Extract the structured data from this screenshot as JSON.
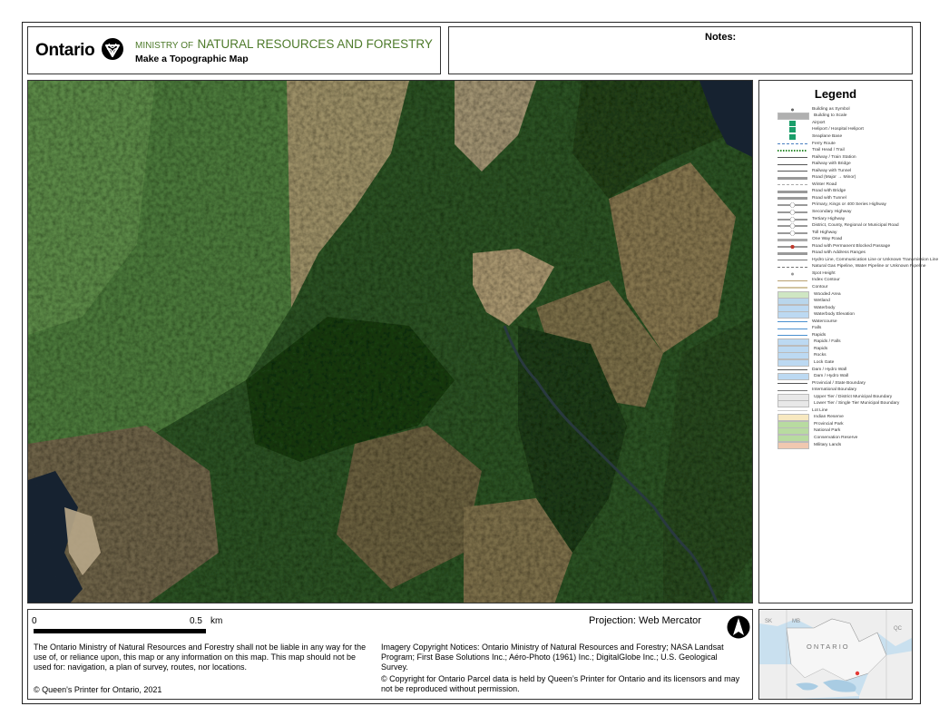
{
  "header": {
    "logo_word": "Ontario",
    "ministry_prefix": "MINISTRY OF",
    "ministry_name": "NATURAL RESOURCES AND FORESTRY",
    "subtitle": "Make a Topographic Map",
    "notes_label": "Notes:"
  },
  "legend": {
    "title": "Legend",
    "items": [
      {
        "label": "Building as Symbol",
        "icon": "dot-icon",
        "color": "#666666"
      },
      {
        "label": "Building to Scale",
        "icon": "building-shape-icon",
        "color": "#b0b0b0"
      },
      {
        "label": "Airport",
        "icon": "airport-icon",
        "color": "#1a9e6a"
      },
      {
        "label": "Heliport / Hospital Heliport",
        "icon": "heliport-icon",
        "color": "#1a9e6a"
      },
      {
        "label": "Seaplane Base",
        "icon": "seaplane-icon",
        "color": "#1a9e6a"
      },
      {
        "label": "Ferry Route",
        "icon": "dashed-line-icon",
        "color": "#4a7fc0"
      },
      {
        "label": "Trail Head / Trail",
        "icon": "trail-icon",
        "color": "#2e8b2e"
      },
      {
        "label": "Railway / Train Station",
        "icon": "railway-icon",
        "color": "#555555"
      },
      {
        "label": "Railway with Bridge",
        "icon": "railway-bridge-icon",
        "color": "#555555"
      },
      {
        "label": "Railway with Tunnel",
        "icon": "railway-tunnel-icon",
        "color": "#555555"
      },
      {
        "label": "Road (Major → Minor)",
        "icon": "road-icon",
        "color": "#999999"
      },
      {
        "label": "Winter Road",
        "icon": "dashed-line-icon",
        "color": "#aaaaaa"
      },
      {
        "label": "Road with Bridge",
        "icon": "road-bridge-icon",
        "color": "#999999"
      },
      {
        "label": "Road with Tunnel",
        "icon": "road-tunnel-icon",
        "color": "#999999"
      },
      {
        "label": "Primary, Kings or 400 Series Highway",
        "icon": "highway-shield-icon",
        "color": "#999999"
      },
      {
        "label": "Secondary Highway",
        "icon": "highway-shield-icon",
        "color": "#999999"
      },
      {
        "label": "Tertiary Highway",
        "icon": "highway-shield-icon",
        "color": "#999999"
      },
      {
        "label": "District, County, Regional or Municipal Road",
        "icon": "highway-shield-icon",
        "color": "#999999"
      },
      {
        "label": "Toll Highway",
        "icon": "highway-shield-icon",
        "color": "#999999"
      },
      {
        "label": "One Way Road",
        "icon": "road-icon",
        "color": "#aaaaaa"
      },
      {
        "label": "Road with Permanent Blocked Passage",
        "icon": "road-blocked-icon",
        "color": "#c0392b"
      },
      {
        "label": "Road with Address Ranges",
        "icon": "road-icon",
        "color": "#999999"
      },
      {
        "label": "Hydro Line, Communication Line or Unknown Transmission Line",
        "icon": "line-icon",
        "color": "#777777"
      },
      {
        "label": "Natural Gas Pipeline, Water Pipeline or Unknown Pipeline",
        "icon": "dashed-line-icon",
        "color": "#777777"
      },
      {
        "label": "Spot Height",
        "icon": "dot-icon",
        "color": "#999999"
      },
      {
        "label": "Index Contour",
        "icon": "line-icon",
        "color": "#b8a070"
      },
      {
        "label": "Contour",
        "icon": "line-icon",
        "color": "#d2c4a0"
      },
      {
        "label": "Wooded Area",
        "icon": "fill-icon",
        "color": "#cfe6c3"
      },
      {
        "label": "Wetland",
        "icon": "fill-icon",
        "color": "#b9d6ec"
      },
      {
        "label": "Waterbody",
        "icon": "fill-icon",
        "color": "#bcd9f2"
      },
      {
        "label": "Waterbody Elevation",
        "icon": "fill-icon",
        "color": "#bcd9f2"
      },
      {
        "label": "Watercourse",
        "icon": "line-icon",
        "color": "#4a90d0"
      },
      {
        "label": "Falls",
        "icon": "line-icon",
        "color": "#4a90d0"
      },
      {
        "label": "Rapids",
        "icon": "line-icon",
        "color": "#4a90d0"
      },
      {
        "label": "Rapids / Falls",
        "icon": "fill-icon",
        "color": "#bcd9f2"
      },
      {
        "label": "Rapids",
        "icon": "fill-icon",
        "color": "#bcd9f2"
      },
      {
        "label": "Rocks",
        "icon": "fill-icon",
        "color": "#bcd9f2"
      },
      {
        "label": "Lock Gate",
        "icon": "fill-icon",
        "color": "#bcd9f2"
      },
      {
        "label": "Dam / Hydro Wall",
        "icon": "line-icon",
        "color": "#555555"
      },
      {
        "label": "Dam / Hydro Wall",
        "icon": "fill-icon",
        "color": "#bcd9f2"
      },
      {
        "label": "Provincial / State Boundary",
        "icon": "line-icon",
        "color": "#555555"
      },
      {
        "label": "International Boundary",
        "icon": "line-icon",
        "color": "#777777"
      },
      {
        "label": "Upper Tier / District Municipal Boundary",
        "icon": "fill-icon",
        "color": "#e8e8e8"
      },
      {
        "label": "Lower Tier / Single Tier Municipal Boundary",
        "icon": "fill-icon",
        "color": "#e8e8e8"
      },
      {
        "label": "Lot Line",
        "icon": "line-icon",
        "color": "#cccccc"
      },
      {
        "label": "Indian Reserve",
        "icon": "fill-icon",
        "color": "#f7e8c0"
      },
      {
        "label": "Provincial Park",
        "icon": "fill-icon",
        "color": "#b8dba0"
      },
      {
        "label": "National Park",
        "icon": "fill-icon",
        "color": "#b8dba0"
      },
      {
        "label": "Conservation Reserve",
        "icon": "fill-icon",
        "color": "#b8dba0"
      },
      {
        "label": "Military Lands",
        "icon": "fill-icon",
        "color": "#f0c8b0"
      }
    ]
  },
  "footer": {
    "scale_start": "0",
    "scale_end": "0.5",
    "scale_unit": "km",
    "projection": "Projection: Web Mercator",
    "disclaimer": "The Ontario Ministry of Natural Resources and Forestry shall not be liable in any way for the use of, or reliance upon, this map or any information on this map.  This map should not be used for: navigation, a plan of survey, routes, nor locations.",
    "copyright": "© Queen's Printer for Ontario, 2021",
    "imagery": "Imagery Copyright Notices: Ontario Ministry of Natural Resources and Forestry; NASA Landsat Program; First Base Solutions Inc.; Aéro-Photo (1961) Inc.; DigitalGlobe Inc.; U.S. Geological Survey.",
    "parcel": "© Copyright for Ontario Parcel data is held by Queen’s Printer for Ontario and its licensors and may not be reproduced without permission."
  },
  "inset": {
    "label": "ONTARIO",
    "corner_labels": [
      "SK",
      "MB",
      "QC"
    ],
    "location_marker_color": "#e53935"
  },
  "colors": {
    "ministry_green": "#4d7a2a",
    "forest_dark": "#1f3a17",
    "forest_mid": "#3d6a2e",
    "forest_light": "#7a9a5a",
    "wetland_tan": "#9a8a60",
    "water": "#1b2a3a"
  }
}
